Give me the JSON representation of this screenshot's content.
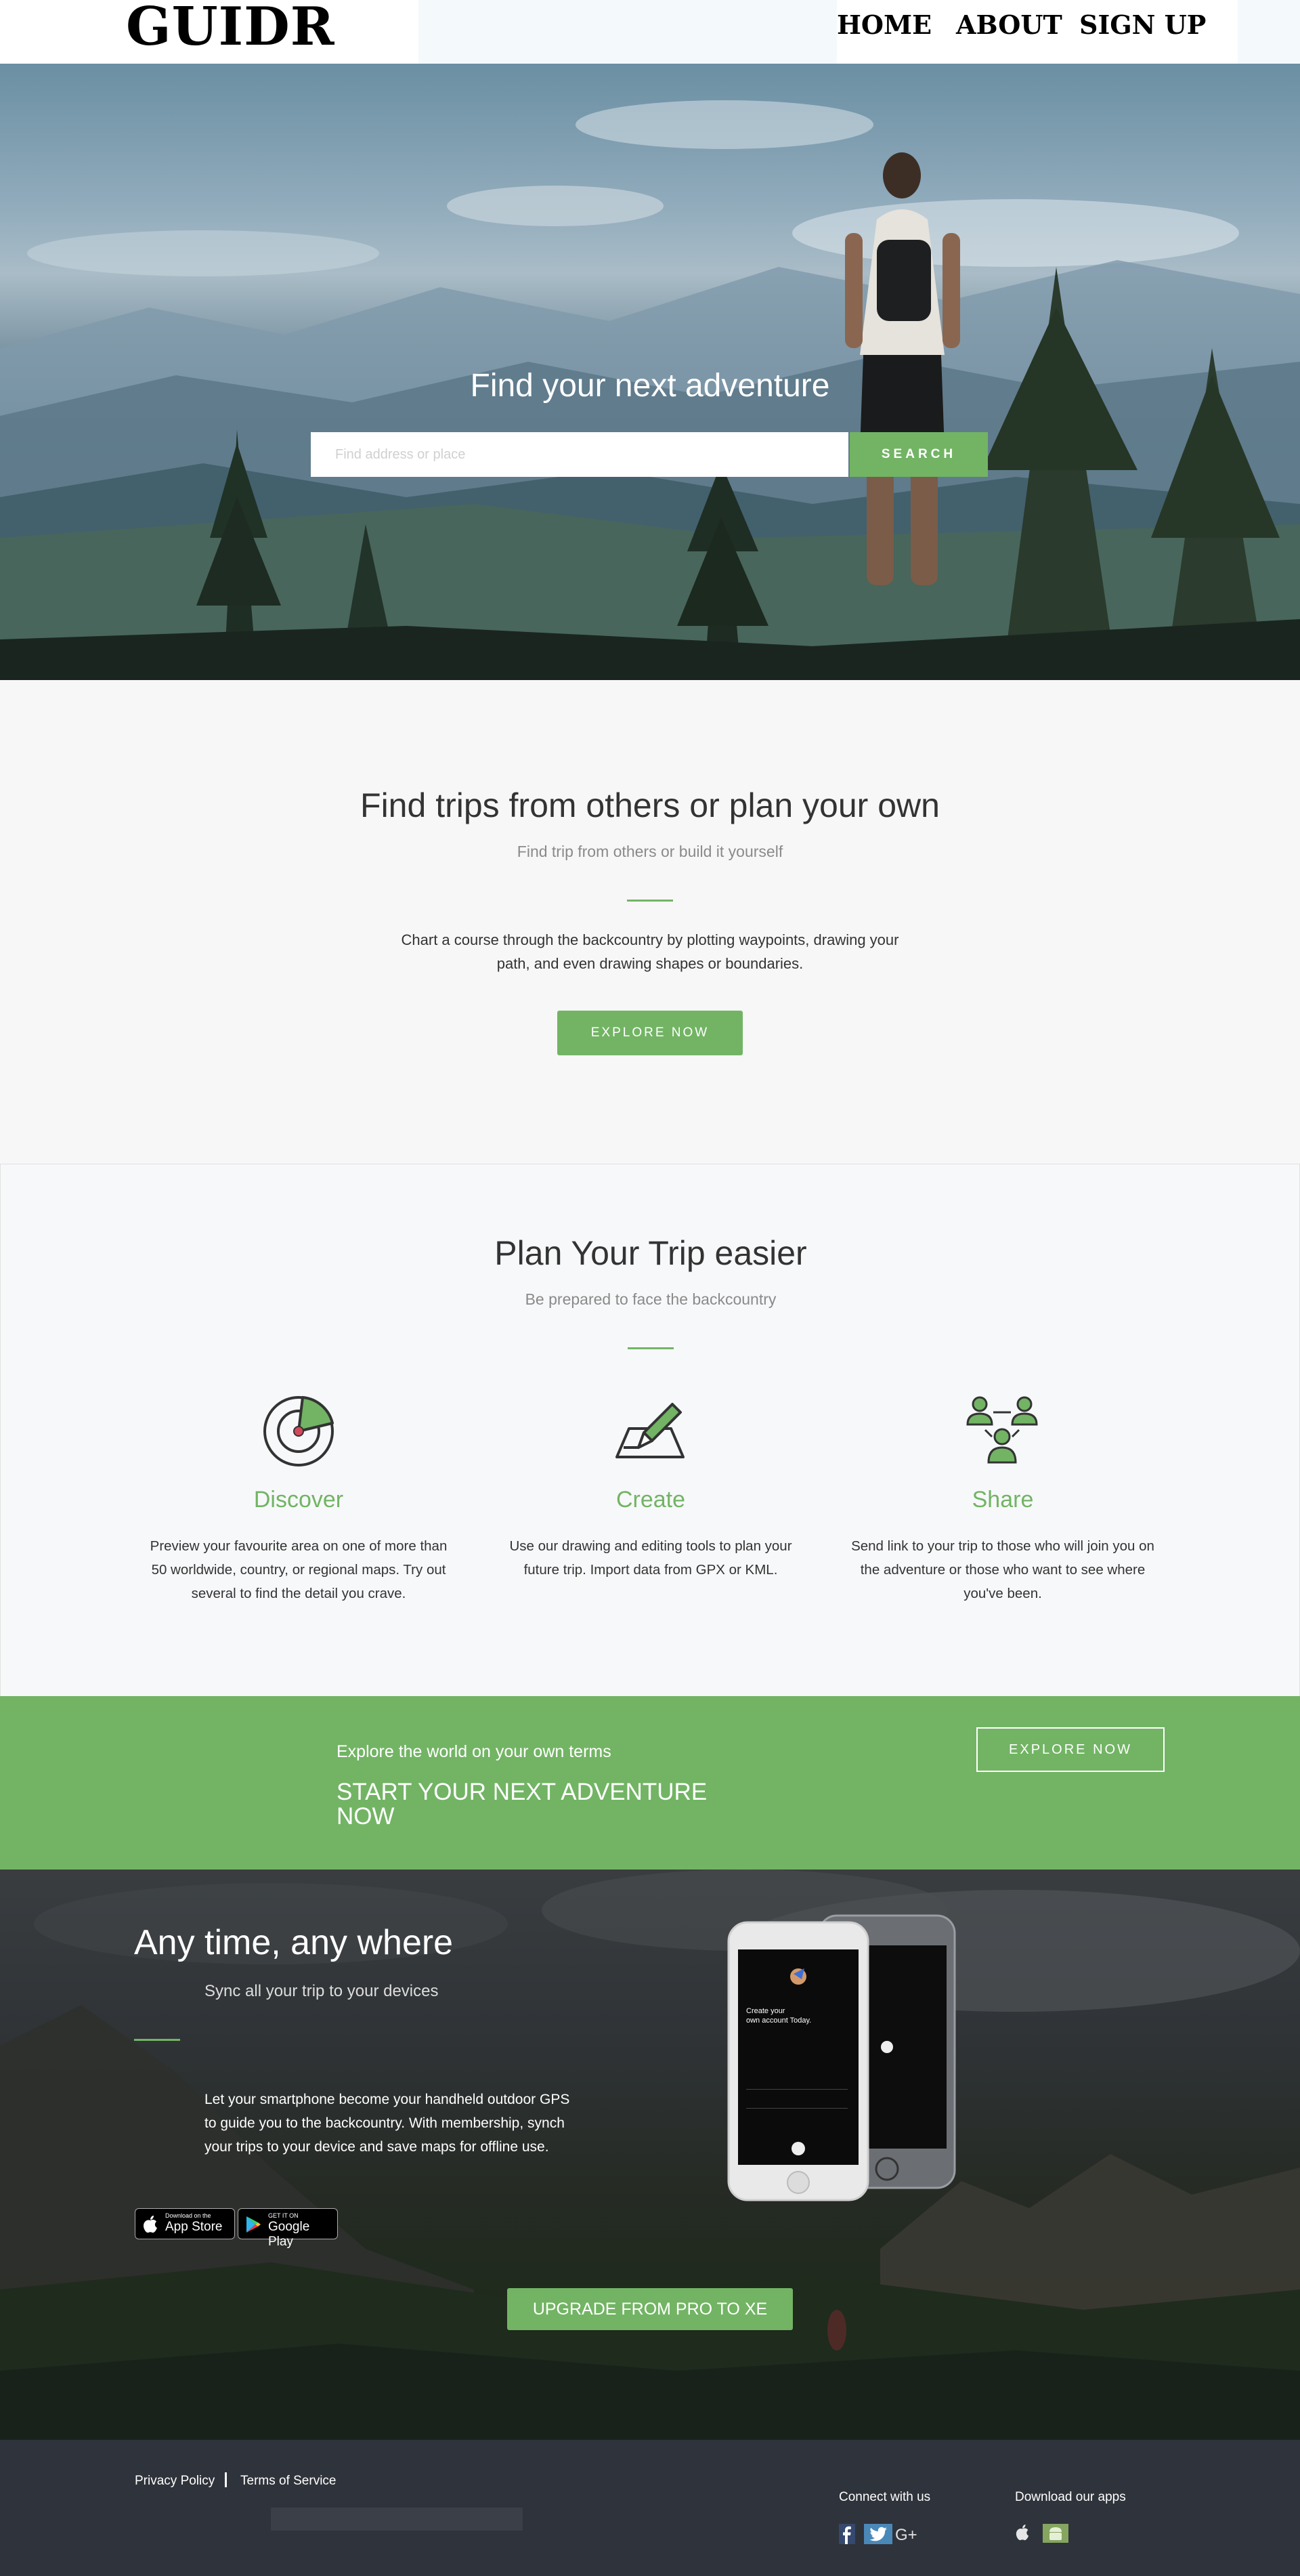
{
  "header": {
    "logo": "GUIDR",
    "nav": [
      "HOME",
      "ABOUT",
      "SIGN UP"
    ]
  },
  "hero": {
    "title": "Find your next adventure",
    "search_placeholder": "Find address or place",
    "search_button": "SEARCH"
  },
  "find_trips": {
    "title": "Find trips from others or plan your own",
    "subtitle": "Find trip from others or build it yourself",
    "text_line1": "Chart a course through the backcountry by plotting waypoints, drawing your",
    "text_line2": "path, and even drawing shapes or boundaries.",
    "button": "EXPLORE NOW"
  },
  "plan": {
    "title": "Plan Your Trip easier",
    "subtitle": "Be prepared to face the backcountry",
    "features": [
      {
        "icon": "radar-icon",
        "title": "Discover",
        "line1": "Preview your favourite area on one of more than",
        "line2": "50 worldwide, country, or regional maps. Try out",
        "line3": "several to find the detail you crave."
      },
      {
        "icon": "pencil-draw-icon",
        "title": "Create",
        "line1": "Use our drawing and editing tools to plan your",
        "line2": "future trip. Import data from GPX or KML.",
        "line3": ""
      },
      {
        "icon": "people-share-icon",
        "title": "Share",
        "line1": "Send link to your trip to those who will join you on",
        "line2": "the adventure or those who want to see where",
        "line3": "you've been."
      }
    ]
  },
  "band": {
    "small": "Explore the world on your own terms",
    "big": "START YOUR NEXT ADVENTURE NOW",
    "button": "EXPLORE NOW"
  },
  "apps": {
    "title": "Any time, any where",
    "subtitle": "Sync all your trip to your devices",
    "text": "Let your smartphone become your handheld outdoor GPS to guide you to the backcountry. With membership, synch your trips to your device and save maps for offline use.",
    "app_store_small": "Download on the",
    "app_store_big": "App Store",
    "google_small": "GET IT ON",
    "google_big": "Google Play",
    "phone_text1": "Create your",
    "phone_text2": "own account Today.",
    "upgrade_button": "UPGRADE FROM PRO TO XE"
  },
  "footer": {
    "privacy": "Privacy Policy",
    "terms": "Terms of Service",
    "connect": "Connect with us",
    "download": "Download our apps"
  },
  "colors": {
    "accent_green": "#72b464",
    "footer_bg": "#2f333b",
    "header_bg": "#f4f9fc"
  }
}
